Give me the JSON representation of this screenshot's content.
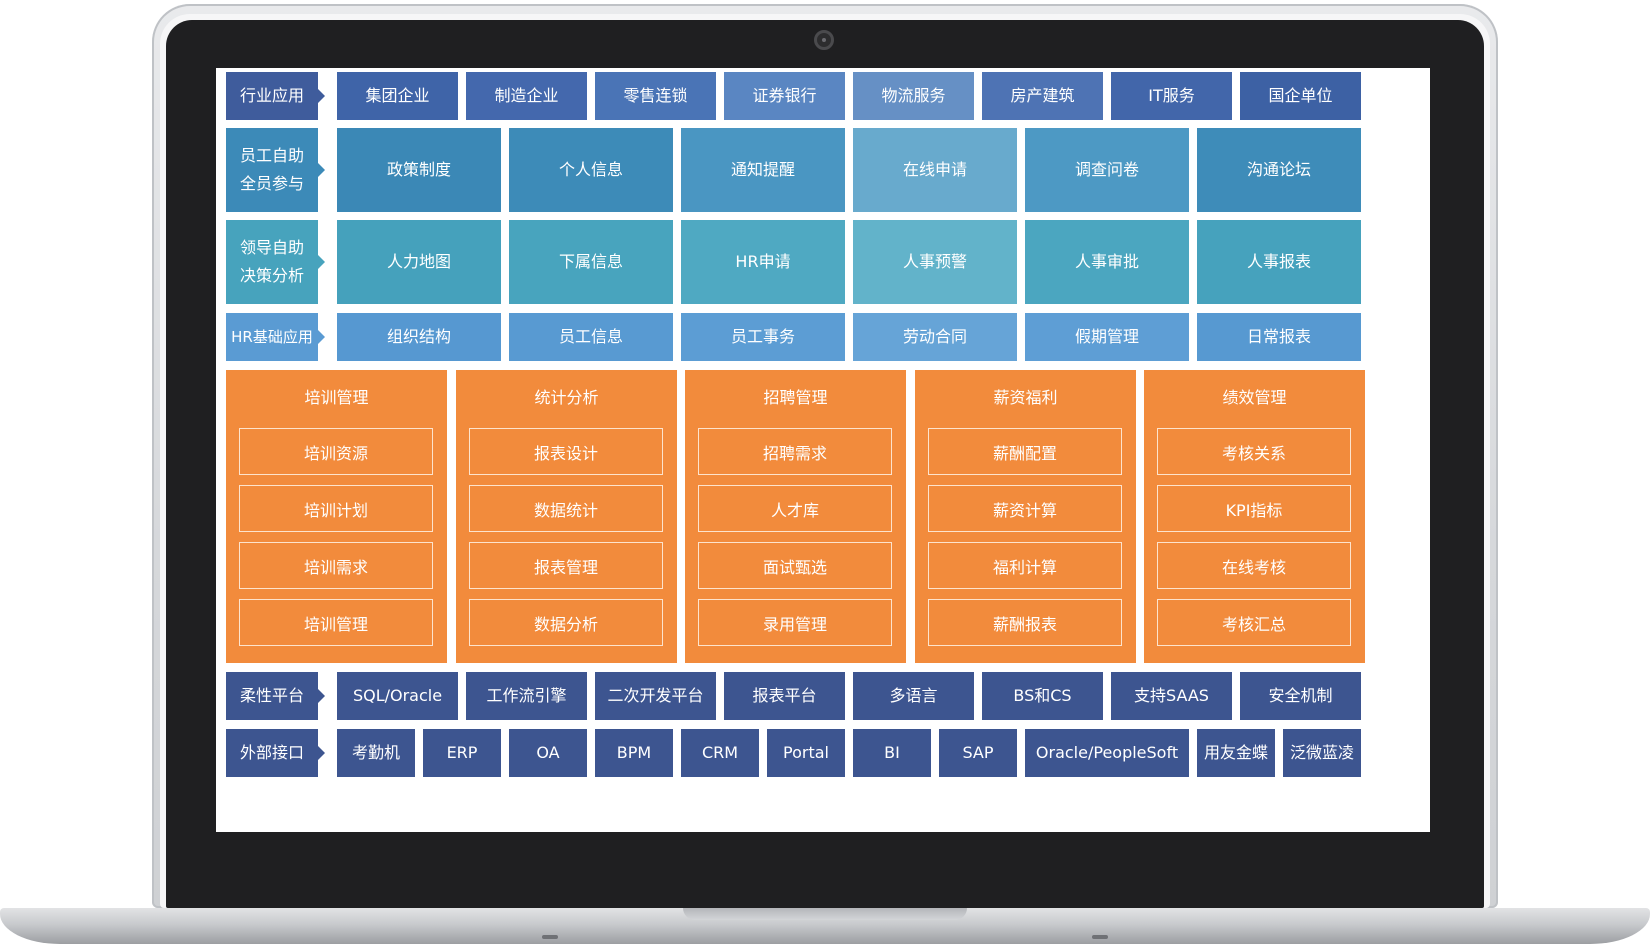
{
  "rows": {
    "industry": {
      "label": "行业应用",
      "items": [
        "集团企业",
        "制造企业",
        "零售连锁",
        "证券银行",
        "物流服务",
        "房产建筑",
        "IT服务",
        "国企单位"
      ]
    },
    "employee_self_service": {
      "label": "员工自助\n全员参与",
      "items": [
        "政策制度",
        "个人信息",
        "通知提醒",
        "在线申请",
        "调查问卷",
        "沟通论坛"
      ]
    },
    "leader_self_service": {
      "label": "领导自助\n决策分析",
      "items": [
        "人力地图",
        "下属信息",
        "HR申请",
        "人事预警",
        "人事审批",
        "人事报表"
      ]
    },
    "hr_basic": {
      "label": "HR基础应用",
      "items": [
        "组织结构",
        "员工信息",
        "员工事务",
        "劳动合同",
        "假期管理",
        "日常报表"
      ]
    },
    "modules": [
      {
        "title": "培训管理",
        "items": [
          "培训资源",
          "培训计划",
          "培训需求",
          "培训管理"
        ]
      },
      {
        "title": "统计分析",
        "items": [
          "报表设计",
          "数据统计",
          "报表管理",
          "数据分析"
        ]
      },
      {
        "title": "招聘管理",
        "items": [
          "招聘需求",
          "人才库",
          "面试甄选",
          "录用管理"
        ]
      },
      {
        "title": "薪资福利",
        "items": [
          "薪酬配置",
          "薪资计算",
          "福利计算",
          "薪酬报表"
        ]
      },
      {
        "title": "绩效管理",
        "items": [
          "考核关系",
          "KPI指标",
          "在线考核",
          "考核汇总"
        ]
      }
    ],
    "flexible_platform": {
      "label": "柔性平台",
      "items": [
        "SQL/Oracle",
        "工作流引擎",
        "二次开发平台",
        "报表平台",
        "多语言",
        "BS和CS",
        "支持SAAS",
        "安全机制"
      ]
    },
    "external_interface": {
      "label": "外部接口",
      "items": [
        "考勤机",
        "ERP",
        "OA",
        "BPM",
        "CRM",
        "Portal",
        "BI",
        "SAP",
        "Oracle/PeopleSoft",
        "用友金蝶",
        "泛微蓝凌"
      ]
    }
  },
  "colors": {
    "navy": "#3f5c9c",
    "row1_cells": [
      "#3f64a8",
      "#4468ad",
      "#4a74b6",
      "#5a86c2",
      "#6390c6",
      "#4a6fb2",
      "#3f64a8",
      "#3a5fa2"
    ],
    "teal_blue": "#3c8ab8",
    "teal": "#47a3bd",
    "light_blue": "#5a9bd3",
    "orange": "#f28b3c",
    "dark_navy": "#3d5590"
  }
}
